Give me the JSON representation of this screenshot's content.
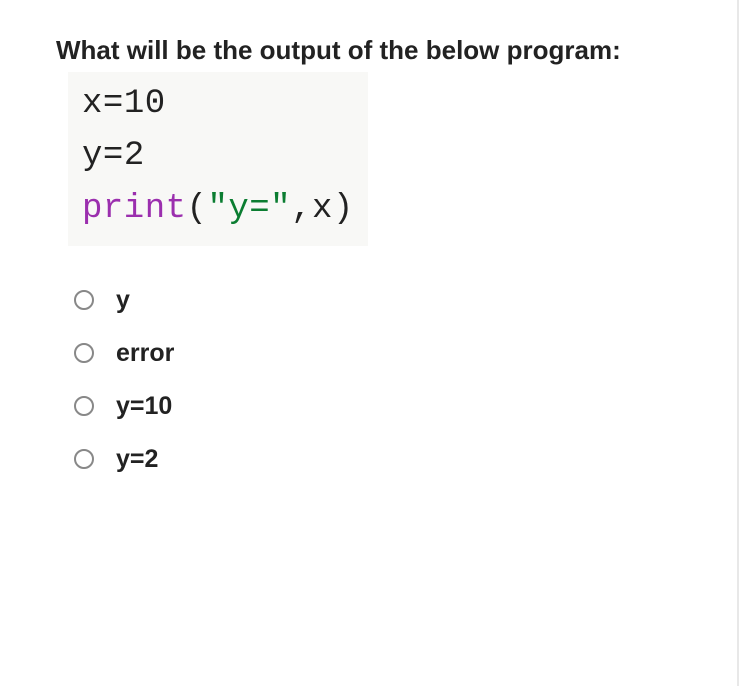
{
  "question": {
    "prompt": "What will be the output of the below program:"
  },
  "code": {
    "line1_pre": "x=",
    "line1_num": "10",
    "line2_pre": "y=",
    "line2_num": "2",
    "line3_fn": "print",
    "line3_open": "(",
    "line3_str": "\"y=\"",
    "line3_rest": ",x)"
  },
  "options": [
    {
      "label": "y"
    },
    {
      "label": "error"
    },
    {
      "label": "y=10"
    },
    {
      "label": "y=2"
    }
  ]
}
